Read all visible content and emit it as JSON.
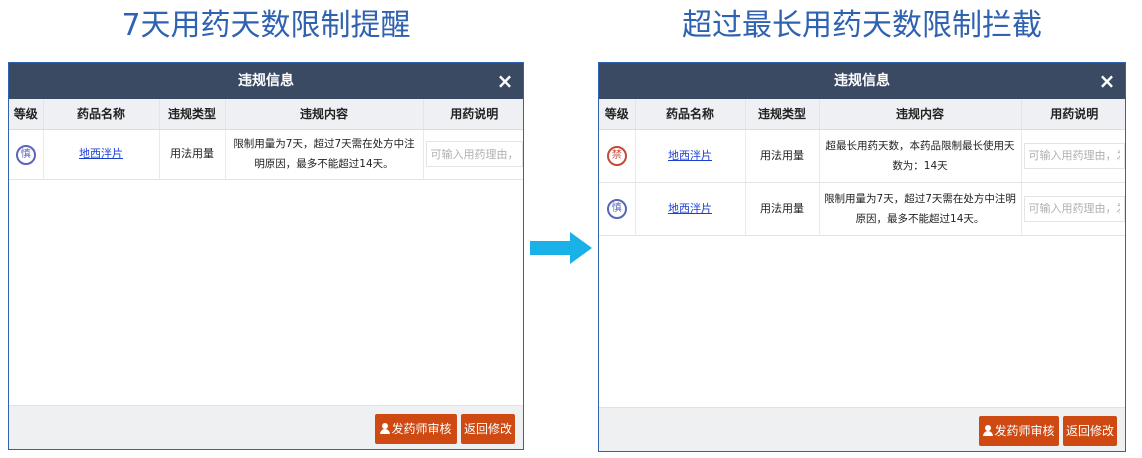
{
  "captions": {
    "left": "7天用药天数限制提醒",
    "right": "超过最长用药天数限制拦截"
  },
  "dialog": {
    "title": "违规信息",
    "close_symbol": "×",
    "columns": [
      "等级",
      "药品名称",
      "违规类型",
      "违规内容",
      "用药说明"
    ],
    "audit_button": "发药师审核",
    "back_button": "返回修改",
    "input_placeholder": "可输入用药理由，发药"
  },
  "left_rows": [
    {
      "level": "慎",
      "level_color": "#5a66b8",
      "drug": "地西泮片",
      "type": "用法用量",
      "content": "限制用量为7天，超过7天需在处方中注明原因，最多不能超过14天。"
    }
  ],
  "right_rows": [
    {
      "level": "禁",
      "level_color": "#c64a3a",
      "drug": "地西泮片",
      "type": "用法用量",
      "content": "超最长用药天数，本药品限制最长使用天数为：14天"
    },
    {
      "level": "慎",
      "level_color": "#5a66b8",
      "drug": "地西泮片",
      "type": "用法用量",
      "content": "限制用量为7天，超过7天需在处方中注明原因，最多不能超过14天。"
    }
  ],
  "arrow_color": "#1ab0e8",
  "header_color": "#3a4a63",
  "button_color": "#cf4a12"
}
